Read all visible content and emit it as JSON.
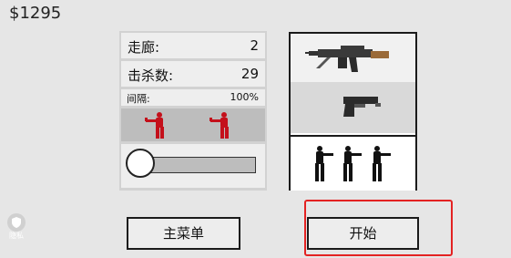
{
  "money": "$1295",
  "stats": {
    "corridor_label": "走廊:",
    "corridor_value": "2",
    "kills_label": "击杀数:",
    "kills_value": "29",
    "interval_label": "间隔:",
    "interval_value": "100%",
    "interval_level": 0.0
  },
  "weapons": [
    {
      "icon": "assault-rifle-icon",
      "selected": false
    },
    {
      "icon": "pistol-icon",
      "selected": true
    },
    {
      "icon": "enemy-squad-icon",
      "selected": false
    }
  ],
  "buttons": {
    "main_menu": "主菜单",
    "start": "开始"
  },
  "privacy_label": "隐私",
  "colors": {
    "background": "#e6e6e6",
    "enemy_red": "#c4101b",
    "highlight_red": "#e32222",
    "rifle_stock": "#9a6a38"
  }
}
